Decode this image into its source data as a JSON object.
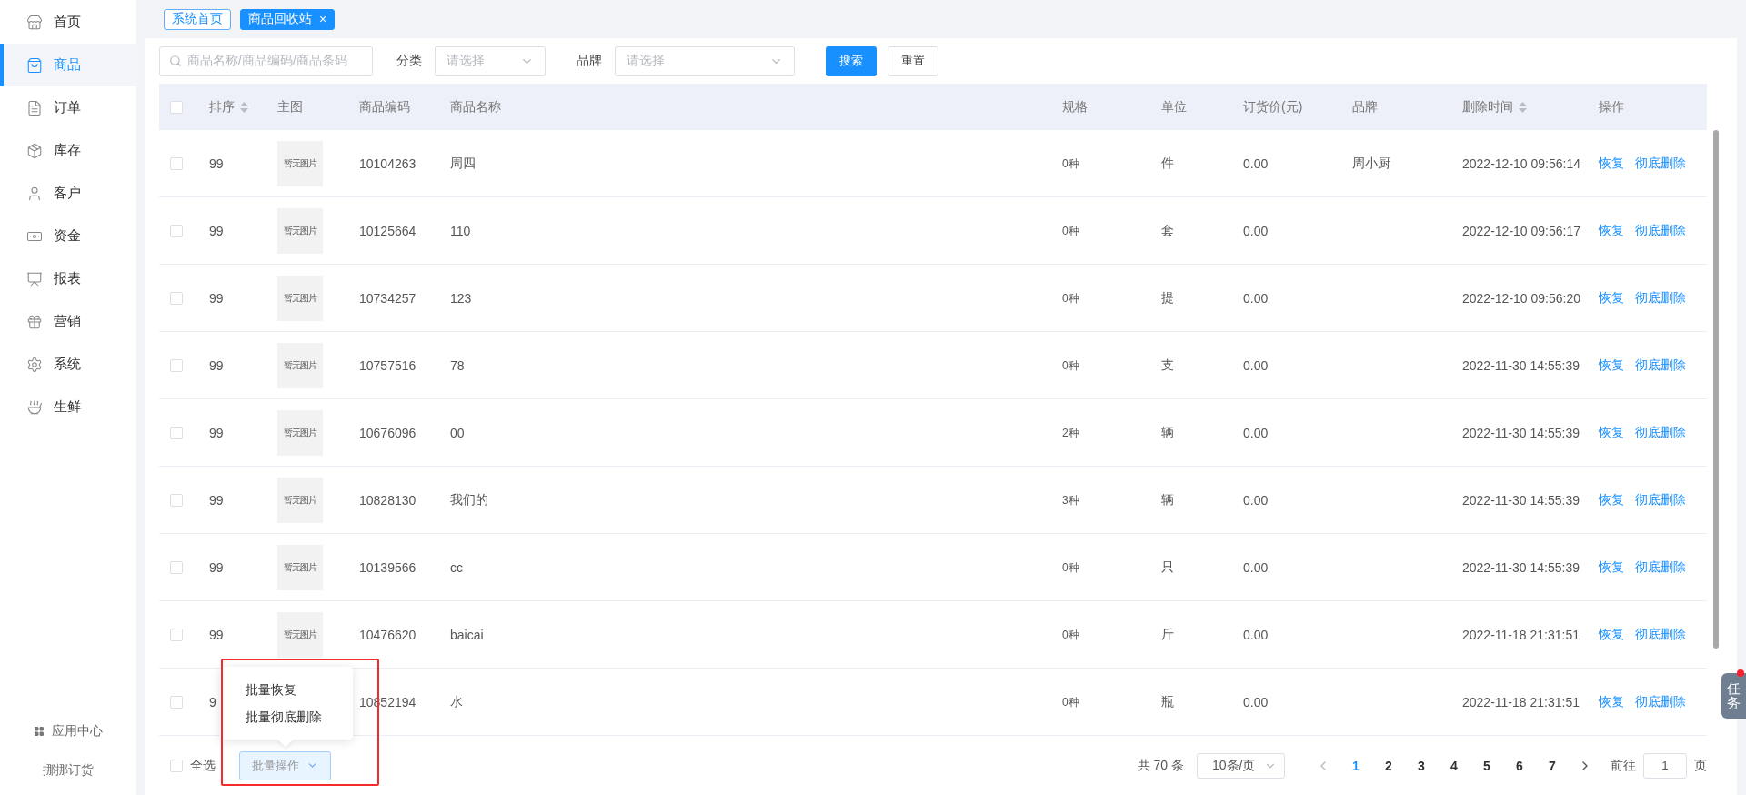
{
  "sidebar": {
    "items": [
      {
        "label": "首页",
        "selected": false
      },
      {
        "label": "商品",
        "selected": true
      },
      {
        "label": "订单",
        "selected": false
      },
      {
        "label": "库存",
        "selected": false
      },
      {
        "label": "客户",
        "selected": false
      },
      {
        "label": "资金",
        "selected": false
      },
      {
        "label": "报表",
        "selected": false
      },
      {
        "label": "营销",
        "selected": false
      },
      {
        "label": "系统",
        "selected": false
      },
      {
        "label": "生鲜",
        "selected": false
      }
    ],
    "app_center": "应用中心",
    "brand": "挪挪订货"
  },
  "tabs": [
    {
      "label": "系统首页",
      "selected": false,
      "closable": false
    },
    {
      "label": "商品回收站",
      "selected": true,
      "closable": true,
      "close": "×"
    }
  ],
  "filters": {
    "search": {
      "placeholder": "商品名称/商品编码/商品条码"
    },
    "category": {
      "label": "分类",
      "placeholder": "请选择"
    },
    "brand": {
      "label": "品牌",
      "placeholder": "请选择"
    },
    "search_button": "搜索",
    "reset_button": "重置"
  },
  "table": {
    "select_all_checked": false,
    "columns": [
      {
        "label": "排序",
        "sortable": true
      },
      {
        "label": "主图",
        "sortable": false
      },
      {
        "label": "商品编码",
        "sortable": false
      },
      {
        "label": "商品名称",
        "sortable": false
      },
      {
        "label": "规格",
        "sortable": false
      },
      {
        "label": "单位",
        "sortable": false
      },
      {
        "label": "订货价(元)",
        "sortable": false
      },
      {
        "label": "品牌",
        "sortable": false
      },
      {
        "label": "删除时间",
        "sortable": true
      },
      {
        "label": "操作",
        "sortable": false
      }
    ],
    "rows": [
      {
        "checked": false,
        "sort": "99",
        "image_text": "暂无图片",
        "code": "10104263",
        "name": "周四",
        "spec": "0种",
        "unit": "件",
        "price": "0.00",
        "brand": "周小厨",
        "deleted_at": "2022-12-10 09:56:14",
        "restore": "恢复",
        "delete": "彻底删除"
      },
      {
        "checked": false,
        "sort": "99",
        "image_text": "暂无图片",
        "code": "10125664",
        "name": "110",
        "spec": "0种",
        "unit": "套",
        "price": "0.00",
        "deleted_at": "2022-12-10 09:56:17",
        "restore": "恢复",
        "delete": "彻底删除"
      },
      {
        "checked": false,
        "sort": "99",
        "image_text": "暂无图片",
        "code": "10734257",
        "name": "123",
        "spec": "0种",
        "unit": "提",
        "price": "0.00",
        "deleted_at": "2022-12-10 09:56:20",
        "restore": "恢复",
        "delete": "彻底删除"
      },
      {
        "checked": false,
        "sort": "99",
        "image_text": "暂无图片",
        "code": "10757516",
        "name": "78",
        "spec": "0种",
        "unit": "支",
        "price": "0.00",
        "deleted_at": "2022-11-30 14:55:39",
        "restore": "恢复",
        "delete": "彻底删除"
      },
      {
        "checked": false,
        "sort": "99",
        "image_text": "暂无图片",
        "code": "10676096",
        "name": "00",
        "spec": "2种",
        "unit": "辆",
        "price": "0.00",
        "deleted_at": "2022-11-30 14:55:39",
        "restore": "恢复",
        "delete": "彻底删除"
      },
      {
        "checked": false,
        "sort": "99",
        "image_text": "暂无图片",
        "code": "10828130",
        "name": "我们的",
        "spec": "3种",
        "unit": "辆",
        "price": "0.00",
        "deleted_at": "2022-11-30 14:55:39",
        "restore": "恢复",
        "delete": "彻底删除"
      },
      {
        "checked": false,
        "sort": "99",
        "image_text": "暂无图片",
        "code": "10139566",
        "name": "cc",
        "spec": "0种",
        "unit": "只",
        "price": "0.00",
        "deleted_at": "2022-11-30 14:55:39",
        "restore": "恢复",
        "delete": "彻底删除"
      },
      {
        "checked": false,
        "sort": "99",
        "image_text": "暂无图片",
        "code": "10476620",
        "name": "baicai",
        "spec": "0种",
        "unit": "斤",
        "price": "0.00",
        "deleted_at": "2022-11-18 21:31:51",
        "restore": "恢复",
        "delete": "彻底删除"
      },
      {
        "checked": false,
        "sort": "9",
        "code": "10852194",
        "name": "水",
        "spec": "0种",
        "unit": "瓶",
        "price": "0.00",
        "deleted_at": "2022-11-18 21:31:51",
        "restore": "恢复",
        "delete": "彻底删除"
      }
    ]
  },
  "footer": {
    "select_all": {
      "label": "全选",
      "checked": false
    },
    "batch_menu": {
      "label": "批量操作",
      "open": true,
      "highlighted": true,
      "items": [
        "批量恢复",
        "批量彻底删除"
      ]
    },
    "pagination": {
      "total": "共 70 条",
      "page_size": "10条/页",
      "pages": [
        {
          "label": "1",
          "selected": true
        },
        {
          "label": "2",
          "selected": false
        },
        {
          "label": "3",
          "selected": false
        },
        {
          "label": "4",
          "selected": false
        },
        {
          "label": "5",
          "selected": false
        },
        {
          "label": "6",
          "selected": false
        },
        {
          "label": "7",
          "selected": false
        }
      ],
      "goto_label": "前往",
      "goto_value": "1",
      "goto_suffix": "页"
    }
  },
  "task_button": {
    "label": "任务",
    "notification": true
  }
}
